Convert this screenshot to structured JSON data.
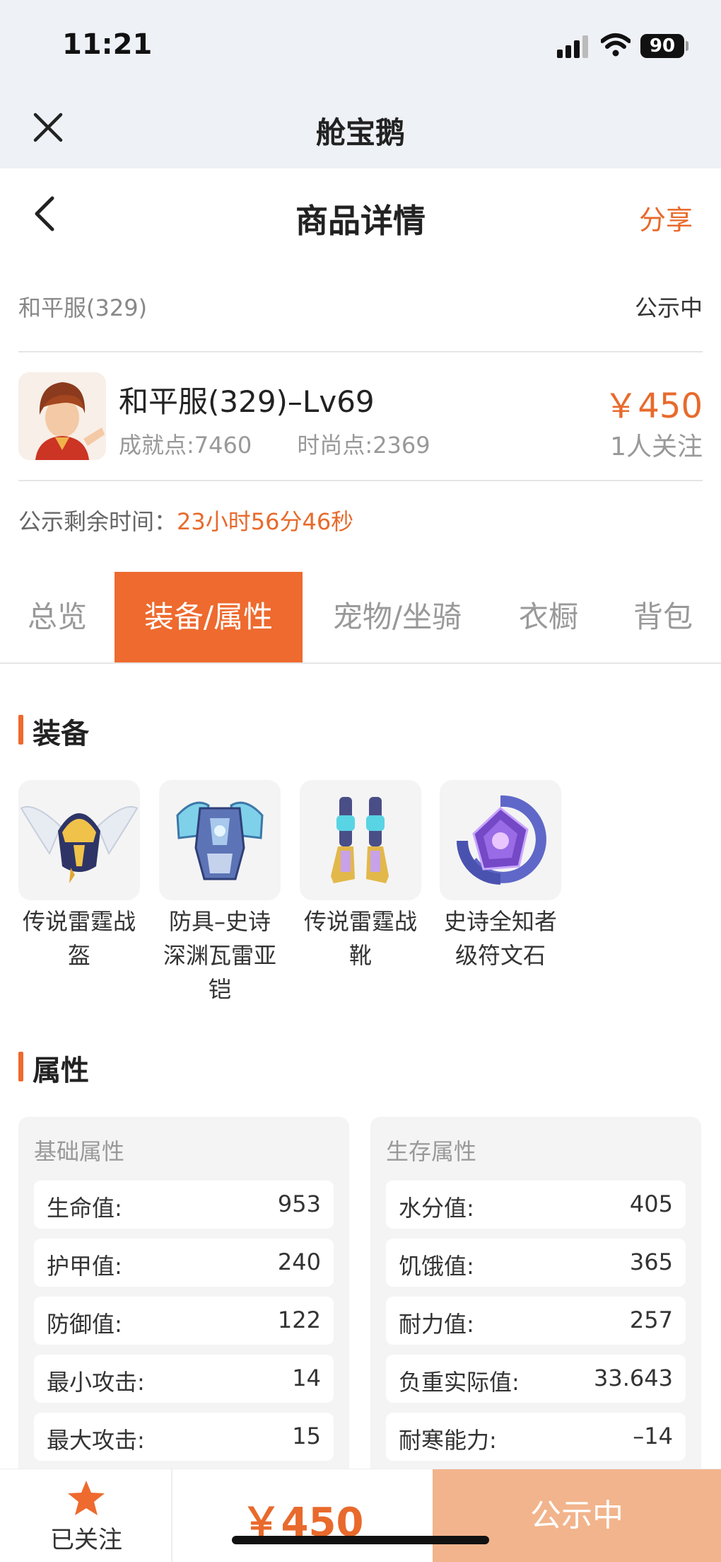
{
  "status_bar": {
    "time": "11:21",
    "battery": "90"
  },
  "mini_program": {
    "title": "舱宝鹅"
  },
  "nav": {
    "title": "商品详情",
    "share": "分享"
  },
  "listing": {
    "server": "和平服(329)",
    "status": "公示中",
    "character_name": "和平服(329)–Lv69",
    "achievement_points": "成就点:7460",
    "fashion_points": "时尚点:2369",
    "price": "￥450",
    "followers": "1人关注",
    "countdown_label": "公示剩余时间：",
    "countdown_value": "23小时56分46秒"
  },
  "tabs": [
    {
      "label": "总览",
      "active": false
    },
    {
      "label": "装备/属性",
      "active": true
    },
    {
      "label": "宠物/坐骑",
      "active": false
    },
    {
      "label": "衣橱",
      "active": false
    },
    {
      "label": "背包",
      "active": false
    }
  ],
  "equipment": {
    "title": "装备",
    "items": [
      {
        "name": "传说雷霆战盔",
        "icon": "helmet-icon"
      },
      {
        "name": "防具–史诗深渊瓦雷亚铠",
        "icon": "armor-icon"
      },
      {
        "name": "传说雷霆战靴",
        "icon": "boots-icon"
      },
      {
        "name": "史诗全知者级符文石",
        "icon": "rune-stone-icon"
      }
    ]
  },
  "attributes": {
    "title": "属性",
    "basic": {
      "title": "基础属性",
      "rows": [
        {
          "label": "生命值:",
          "value": "953"
        },
        {
          "label": "护甲值:",
          "value": "240"
        },
        {
          "label": "防御值:",
          "value": "122"
        },
        {
          "label": "最小攻击:",
          "value": "14"
        },
        {
          "label": "最大攻击:",
          "value": "15"
        }
      ]
    },
    "survival": {
      "title": "生存属性",
      "rows": [
        {
          "label": "水分值:",
          "value": "405"
        },
        {
          "label": "饥饿值:",
          "value": "365"
        },
        {
          "label": "耐力值:",
          "value": "257"
        },
        {
          "label": "负重实际值:",
          "value": "33.643"
        },
        {
          "label": "耐寒能力:",
          "value": "–14"
        }
      ]
    }
  },
  "bottom_bar": {
    "follow_label": "已关注",
    "price": "￥450",
    "action_label": "公示中"
  },
  "colors": {
    "accent": "#ee6a2e",
    "price": "#e86a2c",
    "action_disabled": "#f2b48c"
  }
}
